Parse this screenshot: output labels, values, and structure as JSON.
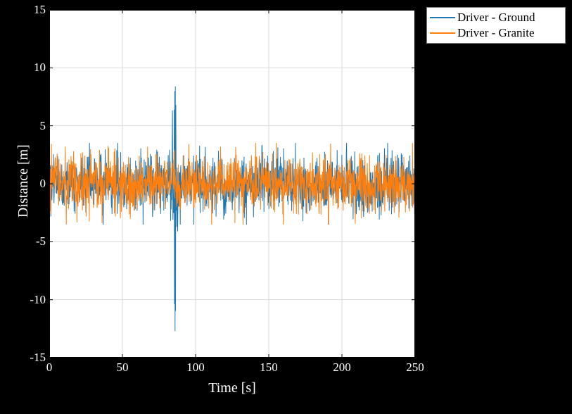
{
  "chart_data": {
    "type": "line",
    "title": "",
    "xlabel": "Time [s]",
    "ylabel": "Distance [m]",
    "xlim": [
      0,
      250
    ],
    "ylim": [
      -15,
      15
    ],
    "xticks": [
      0,
      50,
      100,
      150,
      200,
      250
    ],
    "yticks": [
      -15,
      -10,
      -5,
      0,
      5,
      10,
      15
    ],
    "legend_position": "upper-right-outside",
    "grid": true,
    "series": [
      {
        "name": "Driver - Ground",
        "color": "#1f77b4",
        "description": "Dense noisy signal oscillating roughly between -2 and 2 across 0–250 s, with a large transient spike near t≈86 s reaching approximately +9 upward and about -13 downward.",
        "approx_envelope": {
          "low": -2.2,
          "high": 2.2
        },
        "spikes": [
          {
            "t": 86,
            "min": -13,
            "max": 9
          }
        ]
      },
      {
        "name": "Driver - Granite",
        "color": "#ff7f0e",
        "description": "Dense noisy signal oscillating roughly between -2 and 2 across 0–250 s, occasional peaks to about ±3, no large transient.",
        "approx_envelope": {
          "low": -2.2,
          "high": 2.2
        },
        "spikes": []
      }
    ]
  },
  "legend": {
    "items": [
      {
        "label": "Driver - Ground",
        "color": "#1f77b4"
      },
      {
        "label": "Driver - Granite",
        "color": "#ff7f0e"
      }
    ]
  },
  "axes": {
    "xlabel": "Time [s]",
    "ylabel": "Distance [m]",
    "xticks": [
      "0",
      "50",
      "100",
      "150",
      "200",
      "250"
    ],
    "yticks": [
      "-15",
      "-10",
      "-5",
      "0",
      "5",
      "10",
      "15"
    ]
  }
}
